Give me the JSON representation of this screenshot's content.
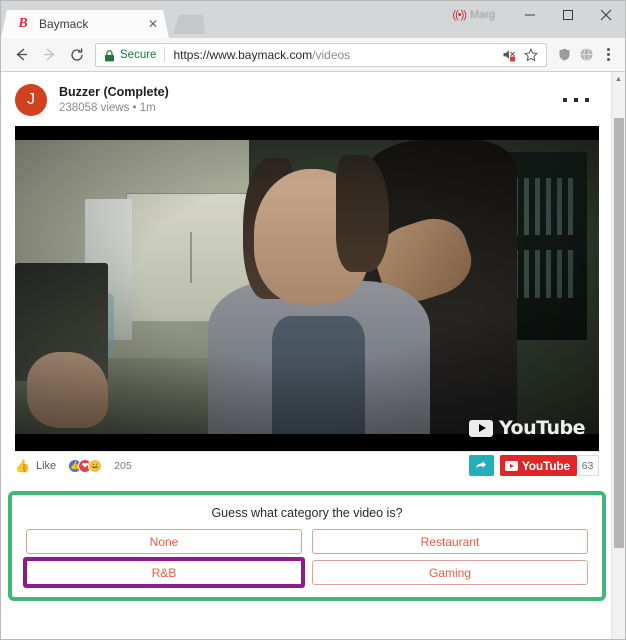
{
  "window": {
    "user_indicator_icon": "cast-active-icon",
    "user_name": "Marg",
    "minimize_label": "–",
    "maximize_label": "□",
    "close_label": "✕"
  },
  "tabstrip": {
    "tabs": [
      {
        "favicon_letter": "B",
        "title": "Baymack",
        "close_label": "✕"
      }
    ],
    "new_tab_label": ""
  },
  "toolbar": {
    "back_label": "←",
    "forward_label": "→",
    "reload_label": "⟳",
    "security_label": "Secure",
    "url_scheme_host": "https://www.baymack.com",
    "url_path": "/videos",
    "mute_icon": "audio-muted-icon",
    "bookmark_icon": "star-icon",
    "extension_1_icon": "extension-shield-icon",
    "extension_2_icon": "extension-globe-icon",
    "menu_icon": "three-dot-menu-icon"
  },
  "post": {
    "avatar_letter": "J",
    "title": "Buzzer (Complete)",
    "subtitle": "238058 views • 1m",
    "more_icon": "three-dot-more-icon"
  },
  "video": {
    "watermark_text": "YouTube",
    "watermark_icon": "youtube-play-icon"
  },
  "actionbar": {
    "thumb_icon": "thumbs-up-icon",
    "like_label": "Like",
    "reactions": [
      {
        "name": "reaction-like",
        "glyph": "👍"
      },
      {
        "name": "reaction-love",
        "glyph": "❤"
      },
      {
        "name": "reaction-haha",
        "glyph": "😁"
      }
    ],
    "reaction_count": "205",
    "share_icon": "share-arrow-icon",
    "youtube_button_label": "YouTube",
    "youtube_count": "63"
  },
  "poll": {
    "question": "Guess what category the video is?",
    "options": [
      {
        "label": "None",
        "selected": false
      },
      {
        "label": "Restaurant",
        "selected": false
      },
      {
        "label": "R&B",
        "selected": true
      },
      {
        "label": "Gaming",
        "selected": false
      }
    ],
    "highlight_color": "#3dba76",
    "selected_color": "#8e1b8e",
    "option_text_color": "#ea5c43"
  },
  "scrollbar": {
    "up_arrow": "▲",
    "down_arrow": "▼"
  }
}
